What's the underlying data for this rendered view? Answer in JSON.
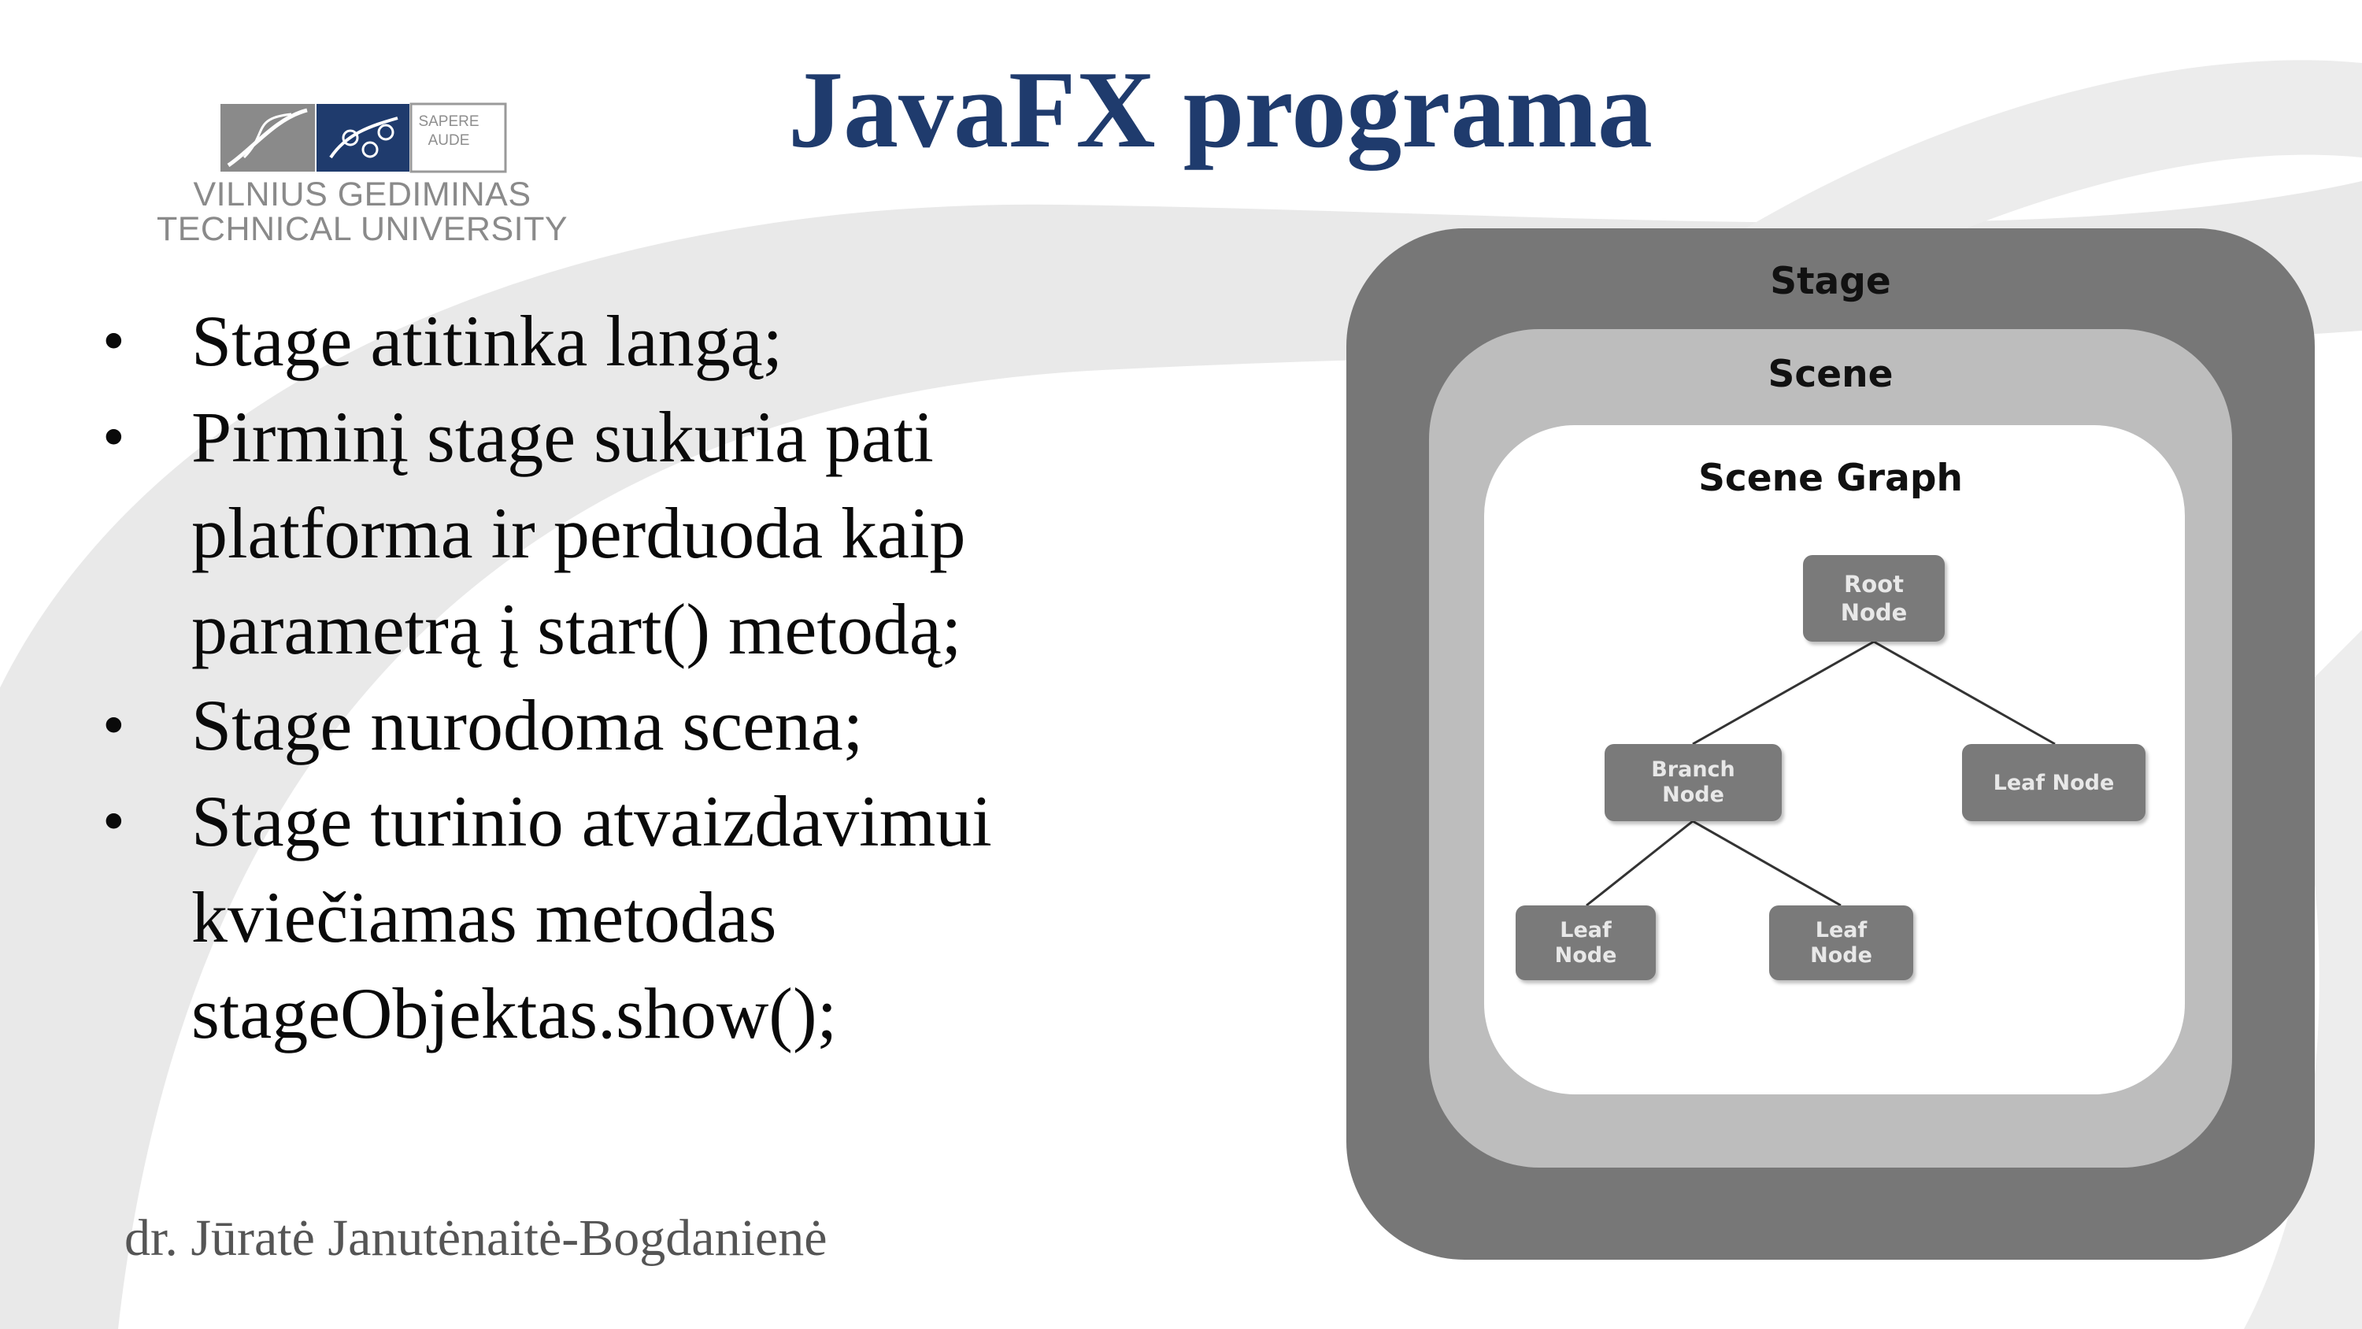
{
  "slide": {
    "title": "JavaFX programa",
    "logo": {
      "line1": "VILNIUS GEDIMINAS",
      "line2": "TECHNICAL UNIVERSITY",
      "motto_line1": "SAPERE",
      "motto_line2": "AUDE"
    },
    "bullets": [
      {
        "lines": [
          "Stage atitinka  langą;"
        ]
      },
      {
        "lines": [
          "Pirminį stage sukuria pati",
          "platforma ir perduoda kaip",
          "parametrą į start() metodą;"
        ]
      },
      {
        "lines": [
          "Stage nurodoma scena;"
        ]
      },
      {
        "lines": [
          "Stage turinio  atvaizdavimui",
          "kviečiamas  metodas",
          "stageObjektas.show();"
        ]
      }
    ],
    "bullet_symbol": "•",
    "author": "dr. Jūratė Janutėnaitė-Bogdanienė"
  },
  "diagram": {
    "stage_label": "Stage",
    "scene_label": "Scene",
    "scene_graph_label": "Scene Graph",
    "nodes": {
      "root": {
        "line1": "Root",
        "line2": "Node"
      },
      "branch": {
        "line1": "Branch",
        "line2": "Node"
      },
      "leaf_right": {
        "label": "Leaf Node"
      },
      "leaf_left": {
        "line1": "Leaf",
        "line2": "Node"
      },
      "leaf_mid": {
        "line1": "Leaf",
        "line2": "Node"
      }
    },
    "colors": {
      "stage": "#777777",
      "scene": "#bdbdbd",
      "graph": "#ffffff",
      "node": "#7a7a7a"
    }
  },
  "colors": {
    "title": "#1f3b6d",
    "text": "#0a0a0a",
    "author": "#555555"
  }
}
